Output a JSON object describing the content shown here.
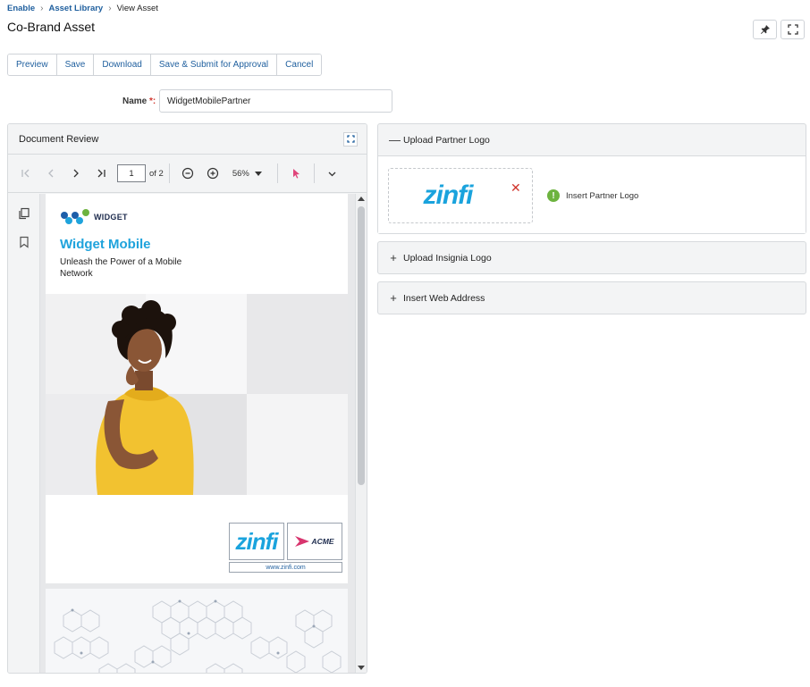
{
  "breadcrumb": {
    "items": [
      "Enable",
      "Asset Library"
    ],
    "current": "View Asset"
  },
  "page": {
    "title": "Co-Brand Asset"
  },
  "toolbar": {
    "buttons": [
      "Preview",
      "Save",
      "Download",
      "Save & Submit for Approval",
      "Cancel"
    ]
  },
  "name_field": {
    "label": "Name",
    "required_mark": "*:",
    "value": "WidgetMobilePartner"
  },
  "document_review": {
    "title": "Document Review",
    "current_page": "1",
    "page_of": "of 2",
    "zoom": "56%",
    "preview": {
      "brand": "WIDGET",
      "headline": "Widget Mobile",
      "tagline": "Unleash the Power of a Mobile Network",
      "partner_logo_text": "zinfi",
      "reseller_logo_text": "ACME",
      "url": "www.zinfi.com"
    }
  },
  "panels": {
    "partner_logo": {
      "sign": "—",
      "title": "Upload Partner Logo",
      "logo_text": "zinfi",
      "hint": "Insert Partner Logo"
    },
    "insignia_logo": {
      "sign": "+",
      "title": "Upload Insignia Logo"
    },
    "web_address": {
      "sign": "+",
      "title": "Insert Web Address"
    }
  },
  "colors": {
    "link": "#1f5f9e",
    "accent": "#1aa3dd",
    "remove": "#d0342c",
    "notice": "#6db33f"
  }
}
